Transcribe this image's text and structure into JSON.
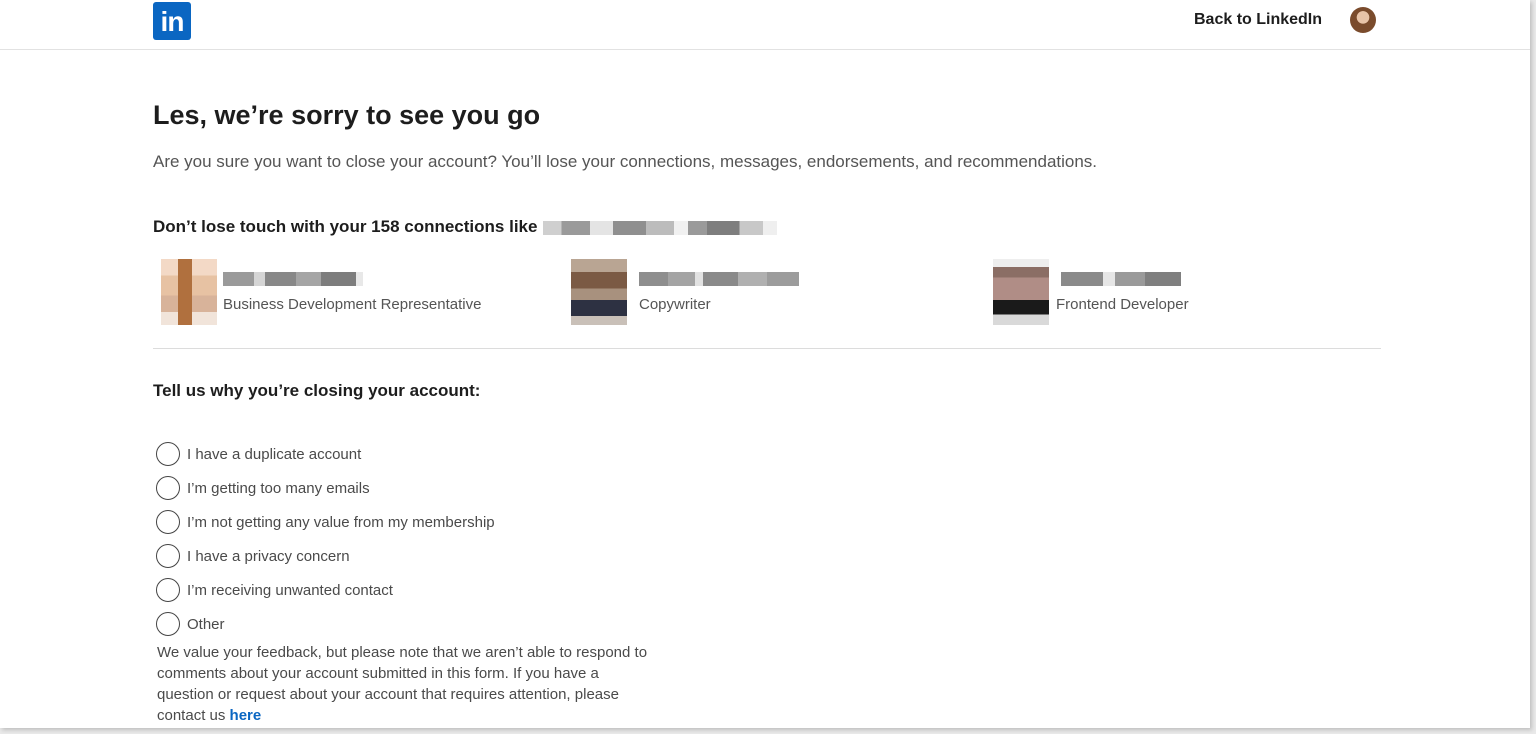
{
  "brand": {
    "logo_text": "in",
    "color": "#0a66c2"
  },
  "header": {
    "back_link": "Back to LinkedIn"
  },
  "page": {
    "title": "Les, we’re sorry to see you go",
    "subtitle": "Are you sure you want to close your account? You’ll lose your connections, messages, endorsements, and recommendations."
  },
  "connections": {
    "heading": "Don’t lose touch with your 158 connections like",
    "items": [
      {
        "title": "Business Development Representative",
        "photo_icon": "avatar-photo"
      },
      {
        "title": "Copywriter",
        "photo_icon": "avatar-photo"
      },
      {
        "title": "Frontend Developer",
        "photo_icon": "avatar-photo"
      }
    ]
  },
  "reasons": {
    "heading": "Tell us why you’re closing your account:",
    "options": [
      "I have a duplicate account",
      "I’m getting too many emails",
      "I’m not getting any value from my membership",
      "I have a privacy concern",
      "I’m receiving unwanted contact",
      "Other"
    ]
  },
  "note": {
    "text": "We value your feedback, but please note that we aren’t able to respond to comments about your account submitted in this form. If you have a question or request about your account that requires attention, please contact us ",
    "link": "here"
  }
}
